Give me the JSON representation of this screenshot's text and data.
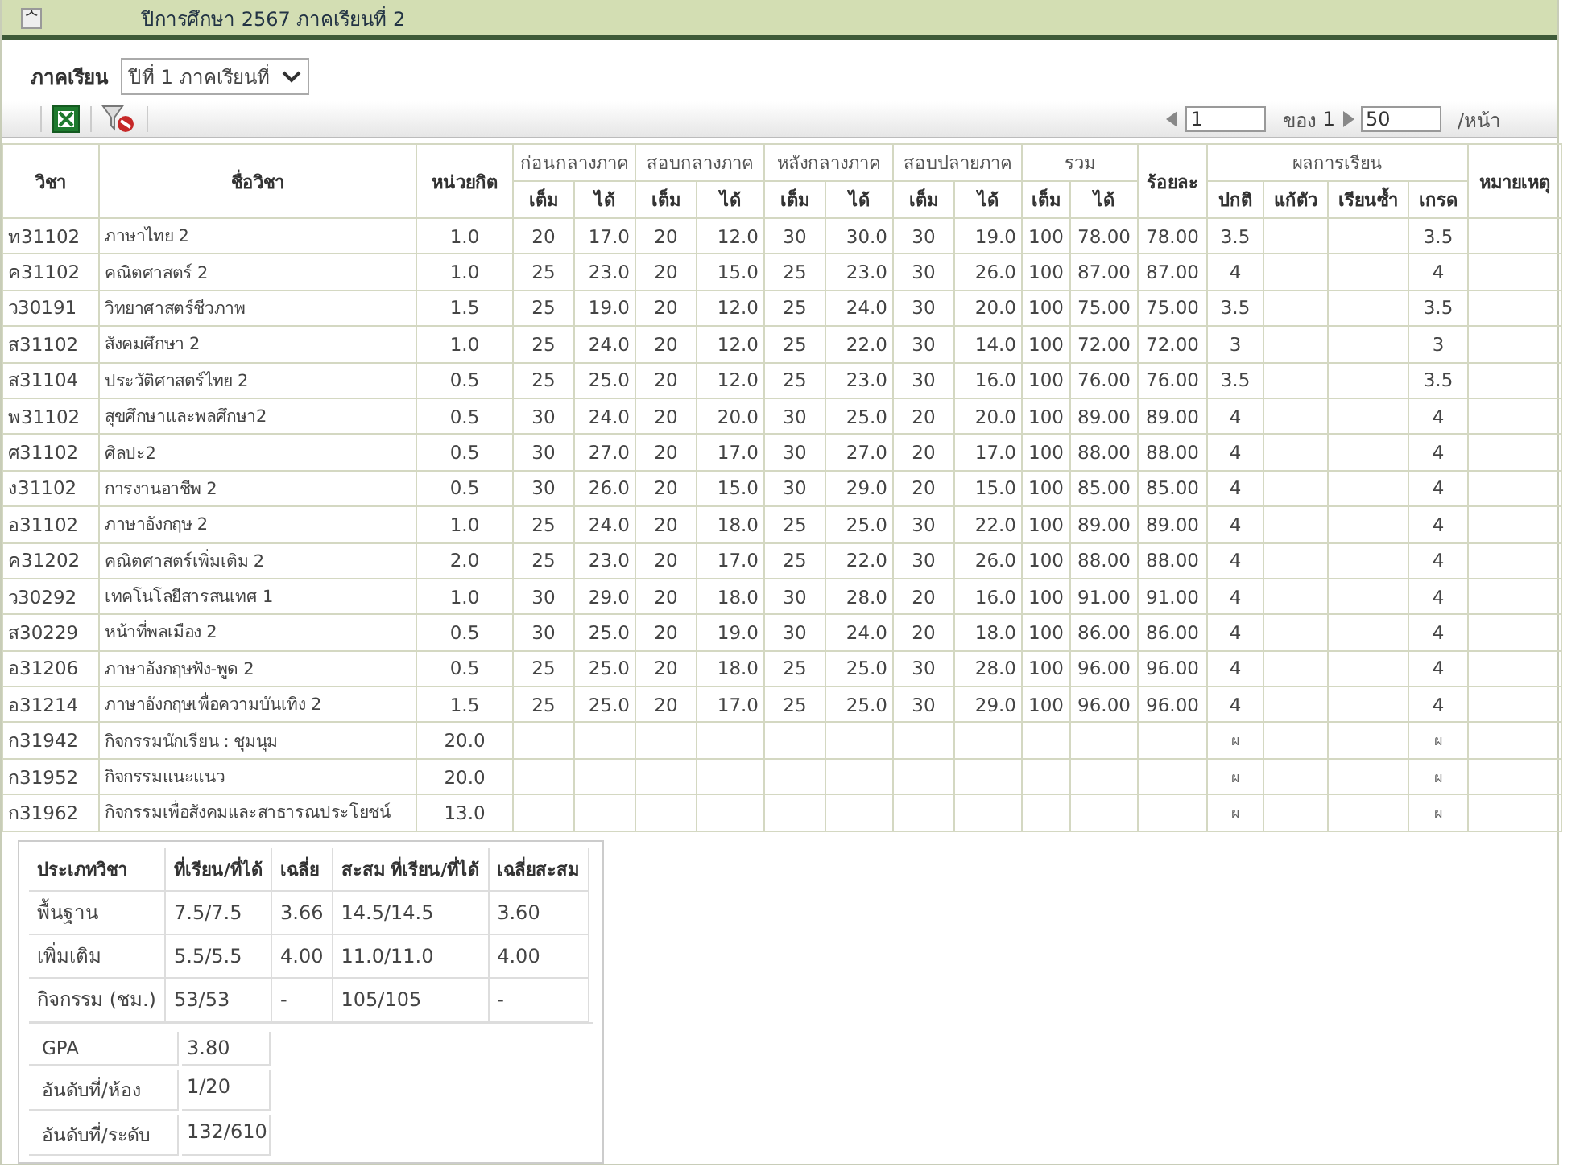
{
  "header": {
    "toggle": "ᄉ",
    "title": "ปีการศึกษา 2567 ภาคเรียนที่ 2"
  },
  "filter": {
    "label": "ภาคเรียน",
    "value": "ปีที่ 1 ภาคเรียนที่"
  },
  "pager": {
    "page": "1",
    "of_label": "ของ",
    "total": "1",
    "page_size": "50",
    "per_page": "/หน้า"
  },
  "columns": {
    "code": "วิชา",
    "name": "ชื่อวิชา",
    "credit": "หน่วยกิต",
    "groups": [
      "ก่อนกลางภาค",
      "สอบกลางภาค",
      "หลังกลางภาค",
      "สอบปลายภาค",
      "รวม"
    ],
    "sub": [
      "เต็ม",
      "ได้",
      "เต็ม",
      "ได้",
      "เต็ม",
      "ได้",
      "เต็ม",
      "ได้",
      "เต็ม",
      "ได้"
    ],
    "percent": "ร้อยละ",
    "result": "ผลการเรียน",
    "result_sub": [
      "ปกติ",
      "แก้ตัว",
      "เรียนซ้ำ",
      "เกรด"
    ],
    "note": "หมายเหตุ"
  },
  "rows": [
    {
      "cells": [
        "ท31102",
        "ภาษาไทย 2",
        "1.0",
        "20",
        "17.0",
        "20",
        "12.0",
        "30",
        "30.0",
        "30",
        "19.0",
        "100",
        "78.00",
        "78.00",
        "3.5",
        null,
        null,
        "3.5",
        null
      ]
    },
    {
      "cells": [
        "ค31102",
        "คณิตศาสตร์ 2",
        "1.0",
        "25",
        "23.0",
        "20",
        "15.0",
        "25",
        "23.0",
        "30",
        "26.0",
        "100",
        "87.00",
        "87.00",
        "4",
        null,
        null,
        "4",
        null
      ]
    },
    {
      "cells": [
        "ว30191",
        "วิทยาศาสตร์ชีวภาพ",
        "1.5",
        "25",
        "19.0",
        "20",
        "12.0",
        "25",
        "24.0",
        "30",
        "20.0",
        "100",
        "75.00",
        "75.00",
        "3.5",
        null,
        null,
        "3.5",
        null
      ]
    },
    {
      "cells": [
        "ส31102",
        "สังคมศึกษา 2",
        "1.0",
        "25",
        "24.0",
        "20",
        "12.0",
        "25",
        "22.0",
        "30",
        "14.0",
        "100",
        "72.00",
        "72.00",
        "3",
        null,
        null,
        "3",
        null
      ]
    },
    {
      "cells": [
        "ส31104",
        "ประวัติศาสตร์ไทย 2",
        "0.5",
        "25",
        "25.0",
        "20",
        "12.0",
        "25",
        "23.0",
        "30",
        "16.0",
        "100",
        "76.00",
        "76.00",
        "3.5",
        null,
        null,
        "3.5",
        null
      ]
    },
    {
      "cells": [
        "พ31102",
        "สุขศึกษาและพลศึกษา2",
        "0.5",
        "30",
        "24.0",
        "20",
        "20.0",
        "30",
        "25.0",
        "20",
        "20.0",
        "100",
        "89.00",
        "89.00",
        "4",
        null,
        null,
        "4",
        null
      ]
    },
    {
      "cells": [
        "ศ31102",
        "ศิลปะ2",
        "0.5",
        "30",
        "27.0",
        "20",
        "17.0",
        "30",
        "27.0",
        "20",
        "17.0",
        "100",
        "88.00",
        "88.00",
        "4",
        null,
        null,
        "4",
        null
      ]
    },
    {
      "cells": [
        "ง31102",
        "การงานอาชีพ 2",
        "0.5",
        "30",
        "26.0",
        "20",
        "15.0",
        "30",
        "29.0",
        "20",
        "15.0",
        "100",
        "85.00",
        "85.00",
        "4",
        null,
        null,
        "4",
        null
      ]
    },
    {
      "cells": [
        "อ31102",
        "ภาษาอังกฤษ 2",
        "1.0",
        "25",
        "24.0",
        "20",
        "18.0",
        "25",
        "25.0",
        "30",
        "22.0",
        "100",
        "89.00",
        "89.00",
        "4",
        null,
        null,
        "4",
        null
      ]
    },
    {
      "cells": [
        "ค31202",
        "คณิตศาสตร์เพิ่มเติม 2",
        "2.0",
        "25",
        "23.0",
        "20",
        "17.0",
        "25",
        "22.0",
        "30",
        "26.0",
        "100",
        "88.00",
        "88.00",
        "4",
        null,
        null,
        "4",
        null
      ]
    },
    {
      "cells": [
        "ว30292",
        "เทคโนโลยีสารสนเทศ 1",
        "1.0",
        "30",
        "29.0",
        "20",
        "18.0",
        "30",
        "28.0",
        "20",
        "16.0",
        "100",
        "91.00",
        "91.00",
        "4",
        null,
        null,
        "4",
        null
      ]
    },
    {
      "cells": [
        "ส30229",
        "หน้าที่พลเมือง 2",
        "0.5",
        "30",
        "25.0",
        "20",
        "19.0",
        "30",
        "24.0",
        "20",
        "18.0",
        "100",
        "86.00",
        "86.00",
        "4",
        null,
        null,
        "4",
        null
      ]
    },
    {
      "cells": [
        "อ31206",
        "ภาษาอังกฤษฟัง-พูด 2",
        "0.5",
        "25",
        "25.0",
        "20",
        "18.0",
        "25",
        "25.0",
        "30",
        "28.0",
        "100",
        "96.00",
        "96.00",
        "4",
        null,
        null,
        "4",
        null
      ]
    },
    {
      "cells": [
        "อ31214",
        "ภาษาอังกฤษเพื่อความบันเทิง 2",
        "1.5",
        "25",
        "25.0",
        "20",
        "17.0",
        "25",
        "25.0",
        "30",
        "29.0",
        "100",
        "96.00",
        "96.00",
        "4",
        null,
        null,
        "4",
        null
      ]
    },
    {
      "cells": [
        "ก31942",
        "กิจกรรมนักเรียน : ชุมนุม",
        "20.0",
        null,
        null,
        null,
        null,
        null,
        null,
        null,
        null,
        null,
        null,
        null,
        "ผ",
        null,
        null,
        "ผ",
        null
      ]
    },
    {
      "cells": [
        "ก31952",
        "กิจกรรมแนะแนว",
        "20.0",
        null,
        null,
        null,
        null,
        null,
        null,
        null,
        null,
        null,
        null,
        null,
        "ผ",
        null,
        null,
        "ผ",
        null
      ]
    },
    {
      "cells": [
        "ก31962",
        "กิจกรรมเพื่อสังคมและสาธารณประโยชน์",
        "13.0",
        null,
        null,
        null,
        null,
        null,
        null,
        null,
        null,
        null,
        null,
        null,
        "ผ",
        null,
        null,
        "ผ",
        null
      ]
    }
  ],
  "summary": {
    "columns": [
      "ประเภทวิชา",
      "ที่เรียน/ที่ได้",
      "เฉลี่ย",
      "สะสม ที่เรียน/ที่ได้",
      "เฉลี่ยสะสม"
    ],
    "rows": [
      [
        "พื้นฐาน",
        "7.5/7.5",
        "3.66",
        "14.5/14.5",
        "3.60"
      ],
      [
        "เพิ่มเติม",
        "5.5/5.5",
        "4.00",
        "11.0/11.0",
        "4.00"
      ],
      [
        "กิจกรรม (ชม.)",
        "53/53",
        "-",
        "105/105",
        "-"
      ]
    ],
    "stats": [
      {
        "label": "GPA",
        "value": "3.80"
      },
      {
        "label": "อันดับที่/ห้อง",
        "value": "1/20"
      },
      {
        "label": "อันดับที่/ระดับ",
        "value": "132/610"
      }
    ]
  }
}
